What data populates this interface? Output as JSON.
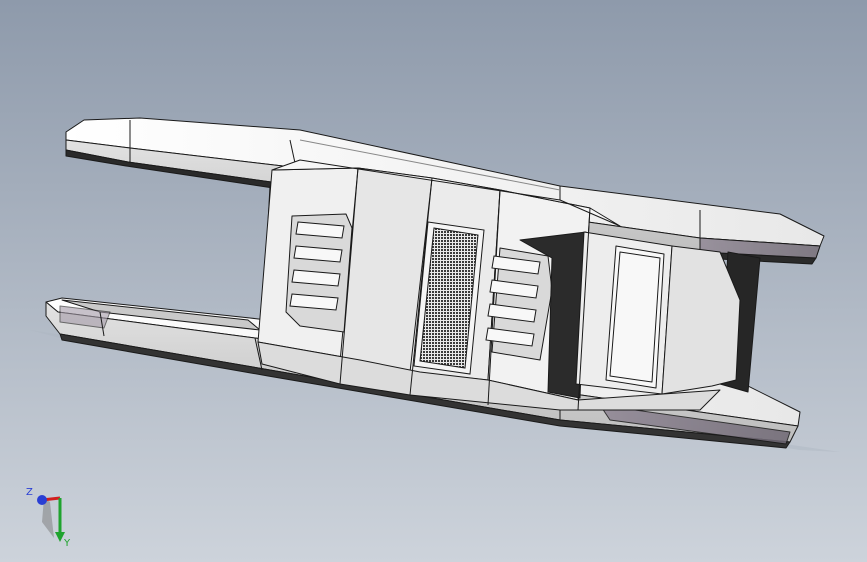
{
  "viewport": {
    "background_top": "#8e9aab",
    "background_bottom": "#cdd3db"
  },
  "model": {
    "body_color": "#f2f2f2",
    "shade_color": "#d4d4d4",
    "dark_color": "#262626",
    "edge_color": "#1a1a1a"
  },
  "triad": {
    "z_label": "Z",
    "y_label": "Y",
    "x_color": "#d11f1f",
    "y_color": "#1fa32e",
    "z_color": "#2a3fd4"
  }
}
